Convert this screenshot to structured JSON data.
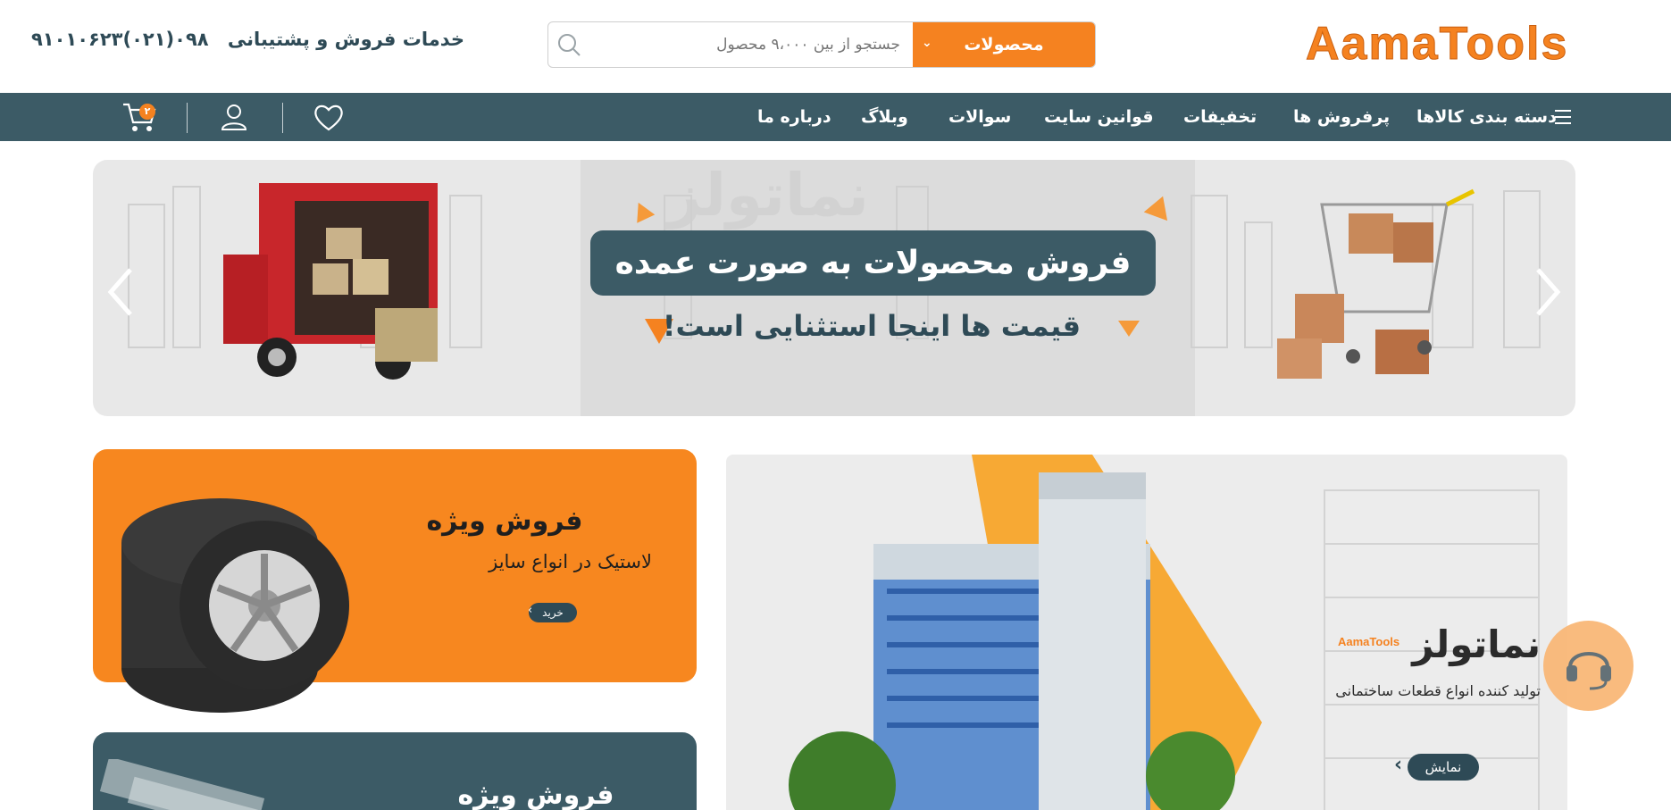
{
  "header": {
    "logo_text": "AamaTools",
    "search": {
      "category_label": "محصولات",
      "placeholder": "جستجو از بین ۹،۰۰۰ محصول"
    },
    "support": {
      "label": "خدمات فروش و پشتیبانی",
      "phone": "۰۹۸(۰۲۱)۹۱۰۱۰۶۲۳"
    }
  },
  "nav": {
    "items": [
      {
        "label": "دسته بندی کالاها"
      },
      {
        "label": "پرفروش ها"
      },
      {
        "label": "تخفیفات"
      },
      {
        "label": "قوانین سایت"
      },
      {
        "label": "سوالات"
      },
      {
        "label": "وبلاگ"
      },
      {
        "label": "درباره ما"
      }
    ],
    "cart_count": "۲",
    "icons": [
      "menu-icon",
      "heart-icon",
      "user-icon",
      "cart-icon"
    ]
  },
  "hero": {
    "title": "فروش محصولات به صورت عمده",
    "subtitle": "قیمت ها اینجا استثنایی است!",
    "watermark": "نماتولز"
  },
  "promo_tires": {
    "title": "فروش ویژه",
    "subtitle": "لاستیک در انواع سایز",
    "button_label": "خرید"
  },
  "promo_second": {
    "title": "فروش ویژه"
  },
  "showcase": {
    "brand_fa": "نماتولز",
    "brand_en": "AamaTools",
    "subtitle": "تولید کننده انواع قطعات ساختمانی",
    "button_label": "نمایش"
  },
  "colors": {
    "accent": "#f58220",
    "primary_dark": "#3c5b66",
    "promo_orange": "#f7871f"
  }
}
